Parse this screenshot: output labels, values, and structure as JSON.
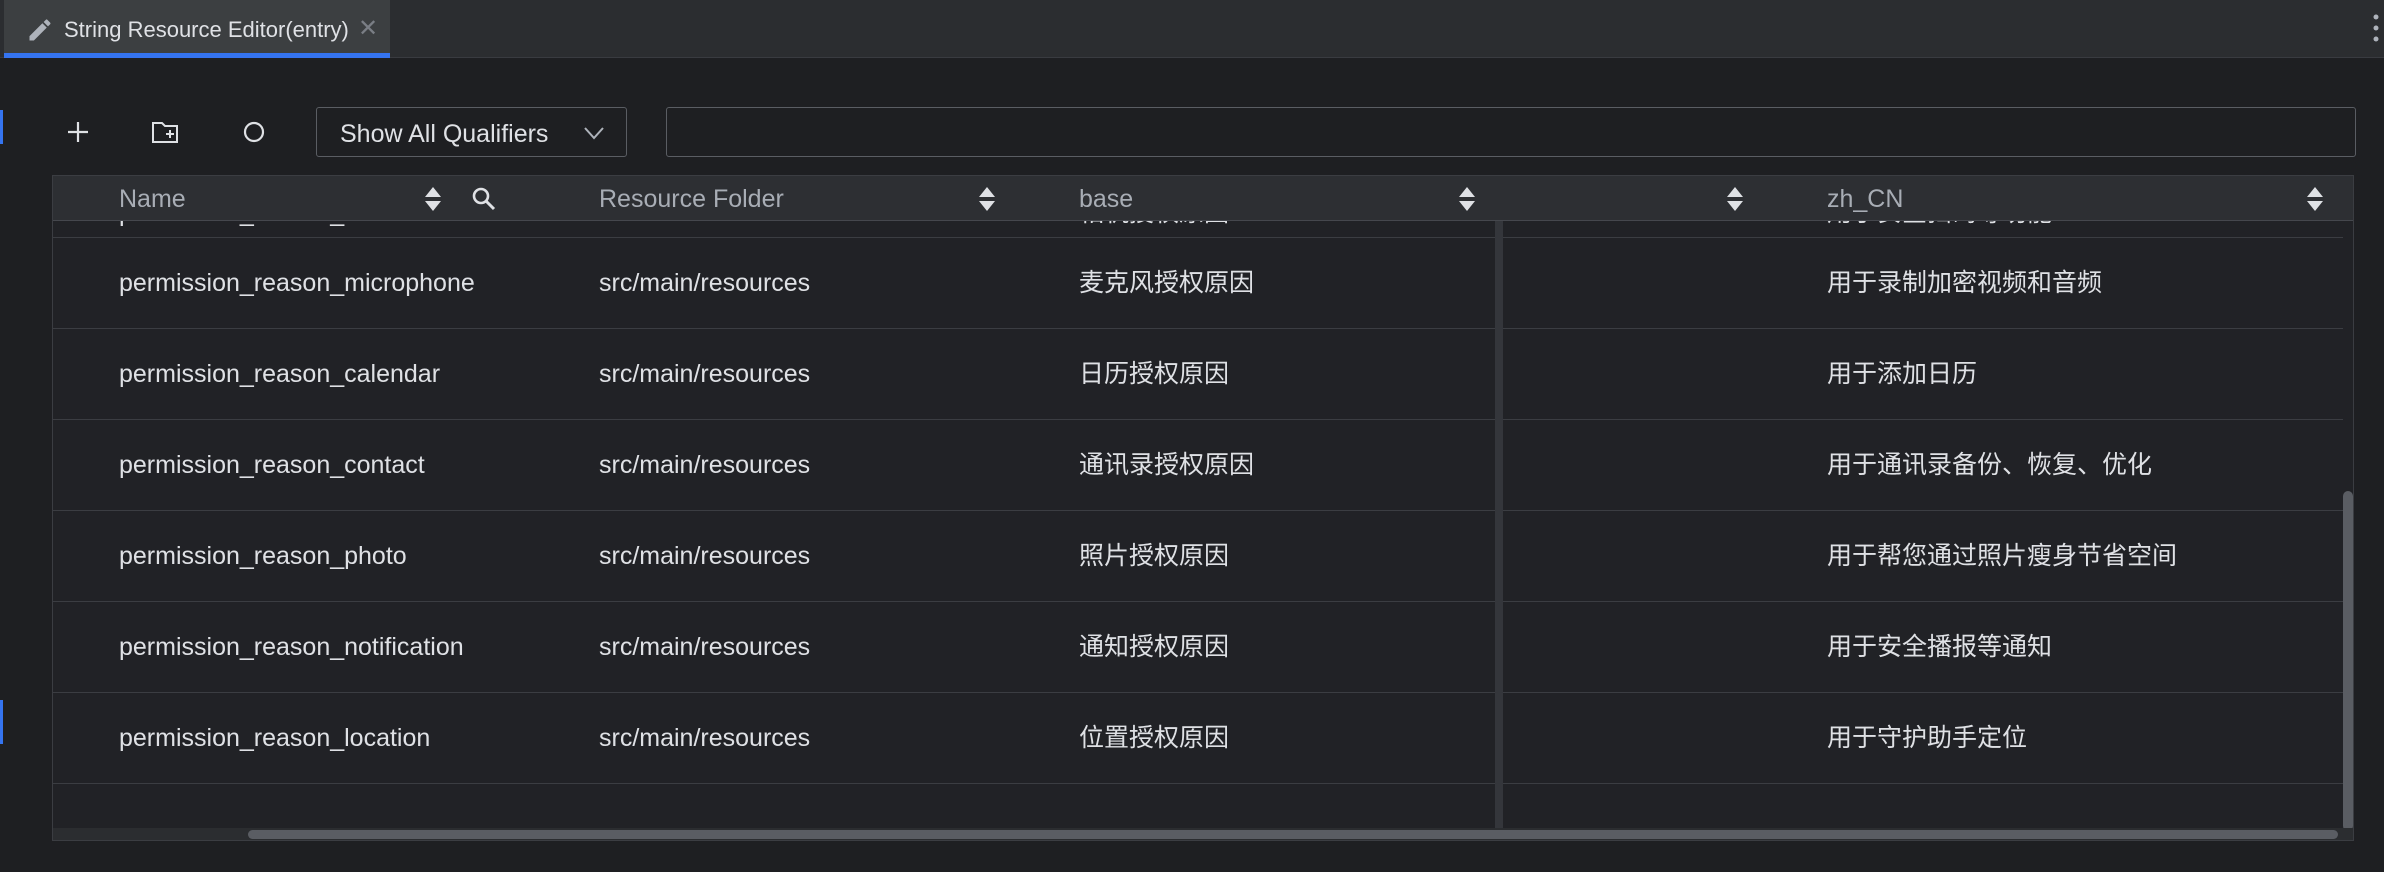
{
  "tab": {
    "title": "String Resource Editor(entry)",
    "close_glyph": "✕",
    "icon": "pencil-icon"
  },
  "toolbar": {
    "add_icon": "plus-icon",
    "add_folder_icon": "folder-add-icon",
    "refresh_icon": "circle-icon",
    "qualifier_label": "Show All Qualifiers",
    "search_value": ""
  },
  "columns": {
    "name": "Name",
    "folder": "Resource Folder",
    "base": "base",
    "empty": "",
    "zh": "zh_CN"
  },
  "rows": [
    {
      "name": "permission_reason_camera",
      "folder": "src/main/resources",
      "base": "相机授权原因",
      "zh": "用于安全扫码等功能"
    },
    {
      "name": "permission_reason_microphone",
      "folder": "src/main/resources",
      "base": "麦克风授权原因",
      "zh": "用于录制加密视频和音频"
    },
    {
      "name": "permission_reason_calendar",
      "folder": "src/main/resources",
      "base": "日历授权原因",
      "zh": "用于添加日历"
    },
    {
      "name": "permission_reason_contact",
      "folder": "src/main/resources",
      "base": "通讯录授权原因",
      "zh": "用于通讯录备份、恢复、优化"
    },
    {
      "name": "permission_reason_photo",
      "folder": "src/main/resources",
      "base": "照片授权原因",
      "zh": "用于帮您通过照片瘦身节省空间"
    },
    {
      "name": "permission_reason_notification",
      "folder": "src/main/resources",
      "base": "通知授权原因",
      "zh": "用于安全播报等通知"
    },
    {
      "name": "permission_reason_location",
      "folder": "src/main/resources",
      "base": "位置授权原因",
      "zh": "用于守护助手定位"
    }
  ],
  "colors": {
    "accent": "#3574f0",
    "background": "#1e1f22",
    "text": "#dfe1e5"
  }
}
